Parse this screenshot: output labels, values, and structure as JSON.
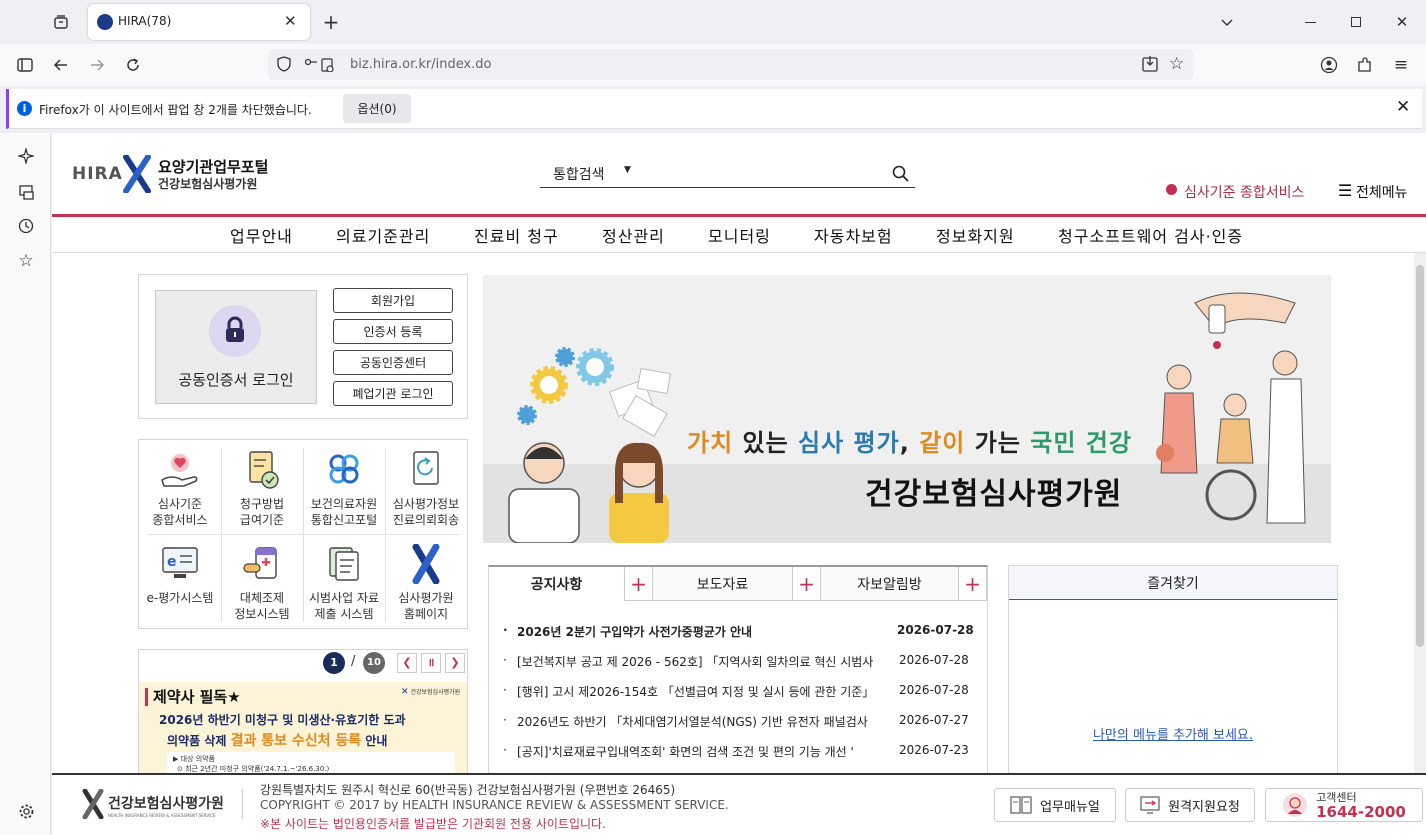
{
  "browser": {
    "tab_title": "HIRA(78)",
    "url": "biz.hira.or.kr/index.do",
    "notification": "Firefox가 이 사이트에서 팝업 창 2개를 차단했습니다.",
    "notification_button": "옵션(0)"
  },
  "site": {
    "logo_text": "HIRA",
    "logo_title": "요양기관업무포털",
    "logo_subtitle": "건강보험심사평가원",
    "search_category": "통합검색",
    "review_service_link": "심사기준 종합서비스",
    "all_menu": "전체메뉴",
    "nav": [
      "업무안내",
      "의료기준관리",
      "진료비 청구",
      "정산관리",
      "모니터링",
      "자동차보험",
      "정보화지원",
      "청구소프트웨어 검사·인증"
    ],
    "login": {
      "cert_login": "공동인증서 로그인",
      "buttons": [
        "회원가입",
        "인증서 등록",
        "공동인증센터",
        "폐업기관 로그인"
      ]
    },
    "quick_links": [
      {
        "label": "심사기준\n종합서비스",
        "icon": "hand-heart-icon"
      },
      {
        "label": "청구방법\n급여기준",
        "icon": "document-check-icon"
      },
      {
        "label": "보건의료자원\n통합신고포털",
        "icon": "network-icon"
      },
      {
        "label": "심사평가정보\n진료의뢰회송",
        "icon": "refresh-doc-icon"
      },
      {
        "label": "e-평가시스템",
        "icon": "monitor-icon"
      },
      {
        "label": "대체조제\n정보시스템",
        "icon": "pills-icon"
      },
      {
        "label": "시범사업 자료\n제출 시스템",
        "icon": "upload-doc-icon"
      },
      {
        "label": "심사평가원\n홈페이지",
        "icon": "hira-logo-icon"
      }
    ],
    "banner_slider": {
      "current": "1",
      "separator": "/",
      "total": "10",
      "headline": "제약사 필독★",
      "line1": "2026년 하반기 미청구 및 미생산·유효기한 도과",
      "line2_a": "의약품 삭제 ",
      "line2_highlight": "결과 통보 수신처 등록",
      "line2_b": " 안내",
      "sub1": "▶ 대상 의약품",
      "sub2": "⊙ 최근 2년간 미청구 의약품('24.7.1.~'26.6.30.)"
    },
    "hero": {
      "slogan_parts": [
        "가치",
        " 있는 ",
        "심사 평가",
        ", ",
        "같이",
        " 가는 ",
        "국민 건강"
      ],
      "org_name": "건강보험심사평가원"
    },
    "board": {
      "tabs": [
        "공지사항",
        "보도자료",
        "자보알림방"
      ],
      "plus": "+",
      "notices": [
        {
          "title": "2026년 2분기 구입약가 사전가중평균가 안내",
          "date": "2026-07-28"
        },
        {
          "title": "[보건복지부 공고 제 2026 - 562호] 「지역사회 일차의료 혁신 시범사",
          "date": "2026-07-28"
        },
        {
          "title": "[행위] 고시 제2026-154호 「선별급여 지정 및 실시 등에 관한 기준」",
          "date": "2026-07-28"
        },
        {
          "title": "2026년도 하반기 「차세대염기서열분석(NGS) 기반 유전자 패널검사",
          "date": "2026-07-27"
        },
        {
          "title": "[공지]'치료재료구입내역조회' 화면의 검색 조건 및 편의 기능 개선 '",
          "date": "2026-07-23"
        }
      ]
    },
    "favorites": {
      "title": "즐겨찾기",
      "empty_link": "나만의 메뉴를 추가해 보세요."
    },
    "footer": {
      "logo": "건강보험심사평가원",
      "logo_en": "HEALTH INSURANCE REVIEW & ASSESSMENT SERVICE",
      "address": "강원특별자치도 원주시 혁신로 60(반곡동) 건강보험심사평가원  (우편번호 26465)",
      "copyright": "COPYRIGHT © 2017 by HEALTH INSURANCE REVIEW & ASSESSMENT SERVICE.",
      "warning": "※본 사이트는 법인용인증서를 발급받은 기관회원 전용 사이트입니다.",
      "manual": "업무매뉴얼",
      "remote": "원격지원요청",
      "center_label": "고객센터",
      "center_phone": "1644-2000"
    }
  }
}
